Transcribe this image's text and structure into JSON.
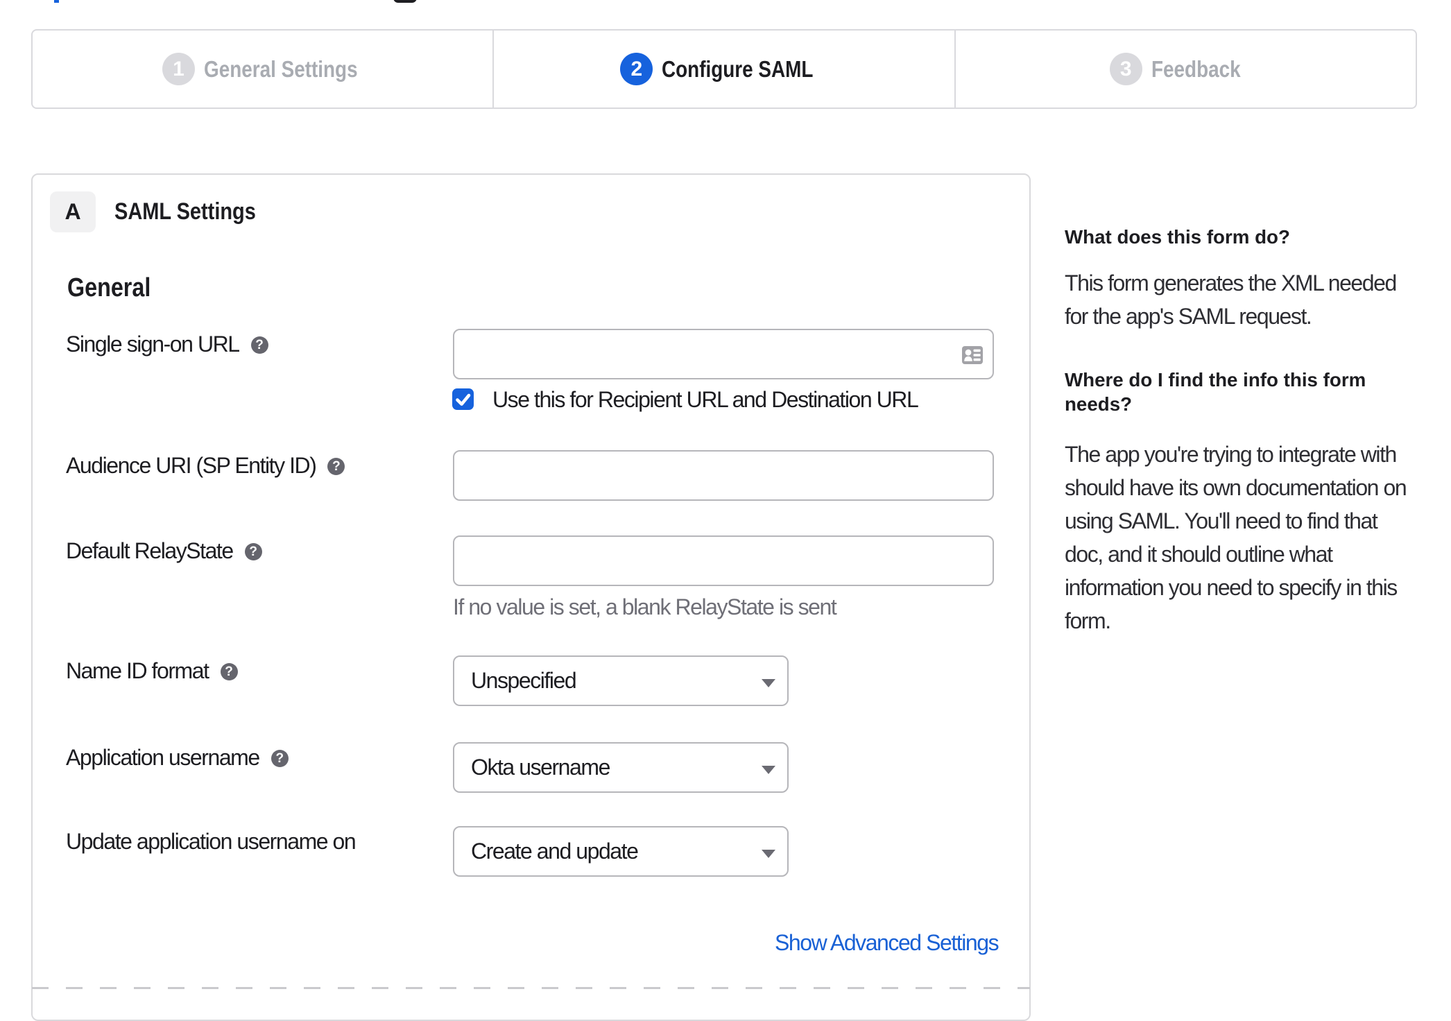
{
  "colors": {
    "accent_blue": "#1662dd",
    "text_dark": "#1d1d21",
    "inactive_gray": "#a9acb2",
    "helper_gray": "#6f6f77",
    "border_gray": "#b6b6ba"
  },
  "wizard": {
    "steps": [
      {
        "number": "1",
        "label": "General Settings",
        "state": "inactive"
      },
      {
        "number": "2",
        "label": "Configure SAML",
        "state": "active"
      },
      {
        "number": "3",
        "label": "Feedback",
        "state": "inactive"
      }
    ]
  },
  "saml_panel": {
    "section_badge": "A",
    "section_title": "SAML Settings",
    "group_heading": "General",
    "fields": [
      {
        "label": "Single sign-on URL",
        "has_help": true,
        "control": "input",
        "value": "",
        "trailing_icon": "contact-card",
        "checkbox": {
          "checked": true,
          "label": "Use this for Recipient URL and Destination URL"
        }
      },
      {
        "label": "Audience URI (SP Entity ID)",
        "has_help": true,
        "control": "input",
        "value": ""
      },
      {
        "label": "Default RelayState",
        "has_help": true,
        "control": "input",
        "value": "",
        "helper": "If no value is set, a blank RelayState is sent"
      },
      {
        "label": "Name ID format",
        "has_help": true,
        "control": "select",
        "value": "Unspecified"
      },
      {
        "label": "Application username",
        "has_help": true,
        "control": "select",
        "value": "Okta username"
      },
      {
        "label": "Update application username on",
        "has_help": false,
        "control": "select",
        "value": "Create and update"
      }
    ],
    "advanced_link": "Show Advanced Settings"
  },
  "help_sidebar": {
    "sections": [
      {
        "heading_lines": [
          "What does this form do?"
        ],
        "body_lines": [
          "This form generates the XML needed",
          "for the app's SAML request."
        ]
      },
      {
        "heading_lines": [
          "Where do I find the info this form",
          "needs?"
        ],
        "body_lines": [
          "The app you're trying to integrate with",
          "should have its own documentation on",
          "using SAML. You'll need to find that",
          "doc, and it should outline what",
          "information you need to specify in this",
          "form."
        ]
      }
    ]
  }
}
